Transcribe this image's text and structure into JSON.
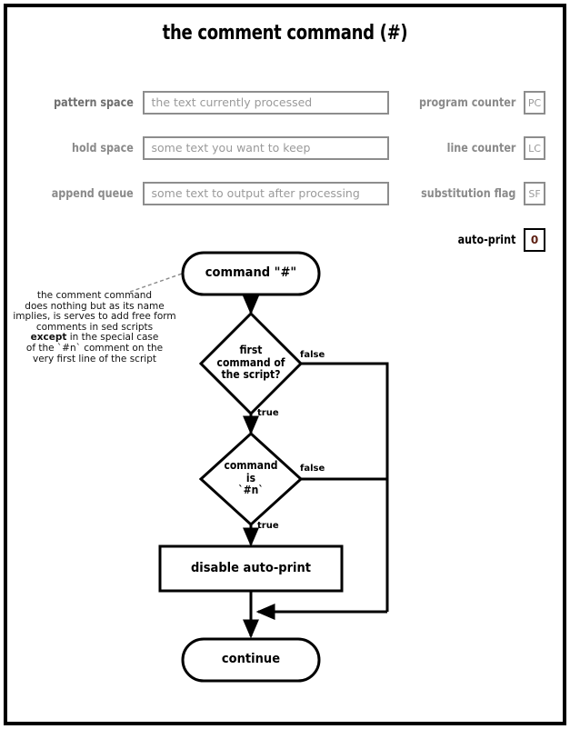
{
  "title": "the comment command (#)",
  "registers": {
    "fields": [
      {
        "label": "pattern space",
        "placeholder": "the text currently processed"
      },
      {
        "label": "hold space",
        "placeholder": "some text you want to keep"
      },
      {
        "label": "append queue",
        "placeholder": "some text to output after processing"
      }
    ],
    "counters": [
      {
        "label": "program counter",
        "value": "PC",
        "active": false
      },
      {
        "label": "line counter",
        "value": "LC",
        "active": false
      },
      {
        "label": "substitution flag",
        "value": "SF",
        "active": false
      },
      {
        "label": "auto-print",
        "value": "0",
        "active": true
      }
    ]
  },
  "annotation": {
    "line1": "the comment command",
    "line2": "does nothing but as its name",
    "line3": "implies, is serves to add free form",
    "line4": "comments in sed scripts",
    "bold": "except",
    "line5": " in the special case",
    "line6": "of the `#n` comment on the",
    "line7": "very first line of the script"
  },
  "flow": {
    "start": "command \"#\"",
    "decision1": "first\ncommand of\nthe script?",
    "decision2": "command\nis\n`#n`",
    "process": "disable auto-print",
    "end": "continue",
    "labels": {
      "false1": "false",
      "true1": "true",
      "false2": "false",
      "true2": "true"
    }
  },
  "colors": {
    "stroke": "#000000",
    "muted": "#8d8d8d",
    "muted_text": "#9a9a9a",
    "label_grey": "#8a8a8a",
    "active_value": "#5d1f12",
    "background": "#ffffff"
  }
}
